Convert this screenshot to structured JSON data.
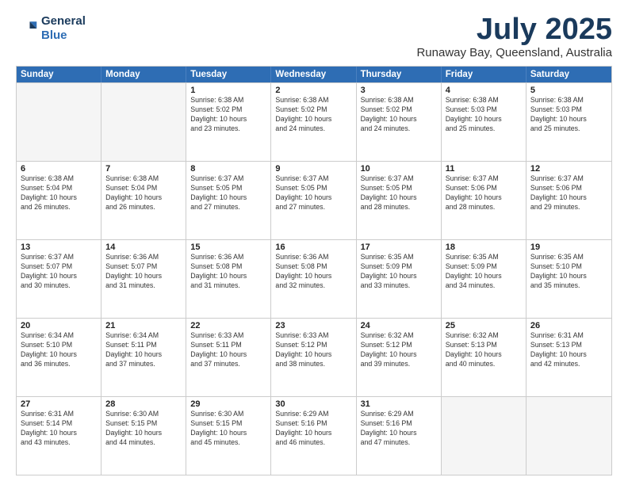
{
  "header": {
    "logo_line1": "General",
    "logo_line2": "Blue",
    "month": "July 2025",
    "location": "Runaway Bay, Queensland, Australia"
  },
  "weekdays": [
    "Sunday",
    "Monday",
    "Tuesday",
    "Wednesday",
    "Thursday",
    "Friday",
    "Saturday"
  ],
  "rows": [
    [
      {
        "day": "",
        "info": ""
      },
      {
        "day": "",
        "info": ""
      },
      {
        "day": "1",
        "info": "Sunrise: 6:38 AM\nSunset: 5:02 PM\nDaylight: 10 hours\nand 23 minutes."
      },
      {
        "day": "2",
        "info": "Sunrise: 6:38 AM\nSunset: 5:02 PM\nDaylight: 10 hours\nand 24 minutes."
      },
      {
        "day": "3",
        "info": "Sunrise: 6:38 AM\nSunset: 5:02 PM\nDaylight: 10 hours\nand 24 minutes."
      },
      {
        "day": "4",
        "info": "Sunrise: 6:38 AM\nSunset: 5:03 PM\nDaylight: 10 hours\nand 25 minutes."
      },
      {
        "day": "5",
        "info": "Sunrise: 6:38 AM\nSunset: 5:03 PM\nDaylight: 10 hours\nand 25 minutes."
      }
    ],
    [
      {
        "day": "6",
        "info": "Sunrise: 6:38 AM\nSunset: 5:04 PM\nDaylight: 10 hours\nand 26 minutes."
      },
      {
        "day": "7",
        "info": "Sunrise: 6:38 AM\nSunset: 5:04 PM\nDaylight: 10 hours\nand 26 minutes."
      },
      {
        "day": "8",
        "info": "Sunrise: 6:37 AM\nSunset: 5:05 PM\nDaylight: 10 hours\nand 27 minutes."
      },
      {
        "day": "9",
        "info": "Sunrise: 6:37 AM\nSunset: 5:05 PM\nDaylight: 10 hours\nand 27 minutes."
      },
      {
        "day": "10",
        "info": "Sunrise: 6:37 AM\nSunset: 5:05 PM\nDaylight: 10 hours\nand 28 minutes."
      },
      {
        "day": "11",
        "info": "Sunrise: 6:37 AM\nSunset: 5:06 PM\nDaylight: 10 hours\nand 28 minutes."
      },
      {
        "day": "12",
        "info": "Sunrise: 6:37 AM\nSunset: 5:06 PM\nDaylight: 10 hours\nand 29 minutes."
      }
    ],
    [
      {
        "day": "13",
        "info": "Sunrise: 6:37 AM\nSunset: 5:07 PM\nDaylight: 10 hours\nand 30 minutes."
      },
      {
        "day": "14",
        "info": "Sunrise: 6:36 AM\nSunset: 5:07 PM\nDaylight: 10 hours\nand 31 minutes."
      },
      {
        "day": "15",
        "info": "Sunrise: 6:36 AM\nSunset: 5:08 PM\nDaylight: 10 hours\nand 31 minutes."
      },
      {
        "day": "16",
        "info": "Sunrise: 6:36 AM\nSunset: 5:08 PM\nDaylight: 10 hours\nand 32 minutes."
      },
      {
        "day": "17",
        "info": "Sunrise: 6:35 AM\nSunset: 5:09 PM\nDaylight: 10 hours\nand 33 minutes."
      },
      {
        "day": "18",
        "info": "Sunrise: 6:35 AM\nSunset: 5:09 PM\nDaylight: 10 hours\nand 34 minutes."
      },
      {
        "day": "19",
        "info": "Sunrise: 6:35 AM\nSunset: 5:10 PM\nDaylight: 10 hours\nand 35 minutes."
      }
    ],
    [
      {
        "day": "20",
        "info": "Sunrise: 6:34 AM\nSunset: 5:10 PM\nDaylight: 10 hours\nand 36 minutes."
      },
      {
        "day": "21",
        "info": "Sunrise: 6:34 AM\nSunset: 5:11 PM\nDaylight: 10 hours\nand 37 minutes."
      },
      {
        "day": "22",
        "info": "Sunrise: 6:33 AM\nSunset: 5:11 PM\nDaylight: 10 hours\nand 37 minutes."
      },
      {
        "day": "23",
        "info": "Sunrise: 6:33 AM\nSunset: 5:12 PM\nDaylight: 10 hours\nand 38 minutes."
      },
      {
        "day": "24",
        "info": "Sunrise: 6:32 AM\nSunset: 5:12 PM\nDaylight: 10 hours\nand 39 minutes."
      },
      {
        "day": "25",
        "info": "Sunrise: 6:32 AM\nSunset: 5:13 PM\nDaylight: 10 hours\nand 40 minutes."
      },
      {
        "day": "26",
        "info": "Sunrise: 6:31 AM\nSunset: 5:13 PM\nDaylight: 10 hours\nand 42 minutes."
      }
    ],
    [
      {
        "day": "27",
        "info": "Sunrise: 6:31 AM\nSunset: 5:14 PM\nDaylight: 10 hours\nand 43 minutes."
      },
      {
        "day": "28",
        "info": "Sunrise: 6:30 AM\nSunset: 5:15 PM\nDaylight: 10 hours\nand 44 minutes."
      },
      {
        "day": "29",
        "info": "Sunrise: 6:30 AM\nSunset: 5:15 PM\nDaylight: 10 hours\nand 45 minutes."
      },
      {
        "day": "30",
        "info": "Sunrise: 6:29 AM\nSunset: 5:16 PM\nDaylight: 10 hours\nand 46 minutes."
      },
      {
        "day": "31",
        "info": "Sunrise: 6:29 AM\nSunset: 5:16 PM\nDaylight: 10 hours\nand 47 minutes."
      },
      {
        "day": "",
        "info": ""
      },
      {
        "day": "",
        "info": ""
      }
    ]
  ]
}
